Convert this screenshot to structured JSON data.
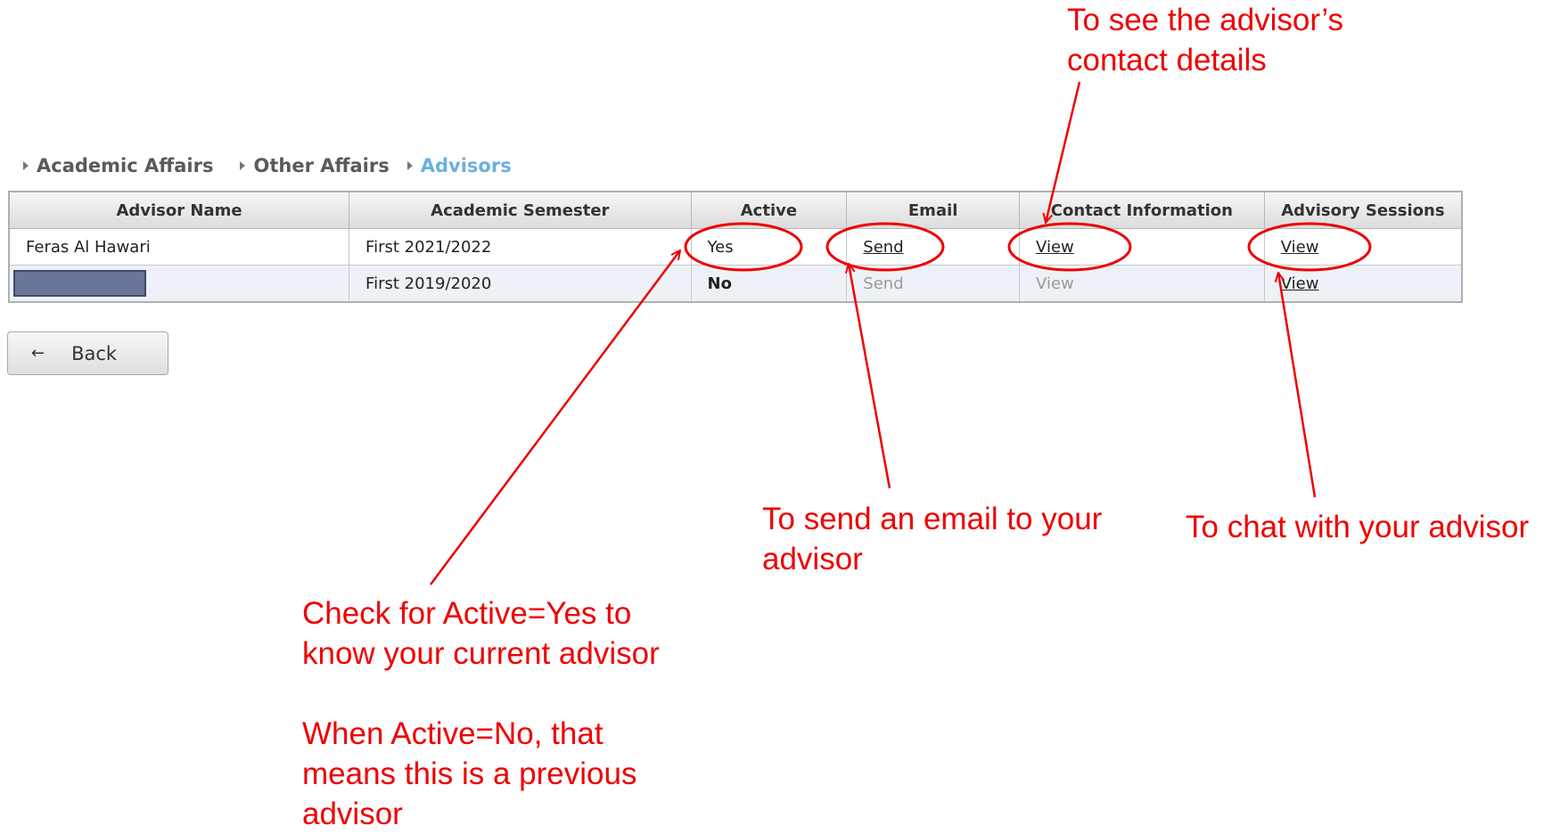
{
  "breadcrumb": [
    "Academic Affairs",
    "Other Affairs",
    "Advisors"
  ],
  "table": {
    "headers": [
      "Advisor Name",
      "Academic Semester",
      "Active",
      "Email",
      "Contact Information",
      "Advisory Sessions"
    ],
    "rows": [
      {
        "advisor_name": "Feras Al Hawari",
        "semester": "First 2021/2022",
        "active": "Yes",
        "email": "Send",
        "contact": "View",
        "sessions": "View"
      },
      {
        "advisor_name": "",
        "semester": "First 2019/2020",
        "active": "No",
        "email": "Send",
        "contact": "View",
        "sessions": "View"
      }
    ]
  },
  "back_label": "Back",
  "annotations": {
    "contact": "To see the advisor’s\ncontact details",
    "email": "To send an email to your\nadvisor",
    "chat": "To chat with your advisor",
    "active": "Check for Active=Yes to\nknow your current advisor\n\nWhen Active=No, that\nmeans this is a previous\nadvisor"
  },
  "colors": {
    "annotation": "#ee0000",
    "breadcrumb_active": "#6ab0de",
    "redaction": "#6b7599"
  }
}
